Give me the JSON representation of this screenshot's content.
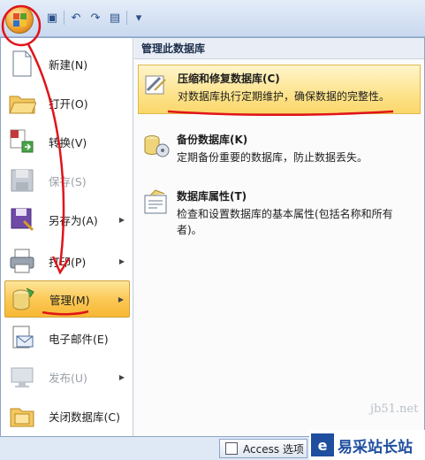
{
  "quick_access": {
    "icons": [
      "save-icon",
      "undo-icon",
      "redo-icon",
      "customize-icon"
    ]
  },
  "left_menu": {
    "items": [
      {
        "label": "新建(N)",
        "icon": "new-file-icon",
        "enabled": true,
        "has_submenu": false
      },
      {
        "label": "打开(O)",
        "icon": "open-folder-icon",
        "enabled": true,
        "has_submenu": false
      },
      {
        "label": "转换(V)",
        "icon": "convert-icon",
        "enabled": true,
        "has_submenu": false
      },
      {
        "label": "保存(S)",
        "icon": "save-icon",
        "enabled": false,
        "has_submenu": false
      },
      {
        "label": "另存为(A)",
        "icon": "save-as-icon",
        "enabled": true,
        "has_submenu": true
      },
      {
        "label": "打印(P)",
        "icon": "printer-icon",
        "enabled": true,
        "has_submenu": true
      },
      {
        "label": "管理(M)",
        "icon": "manage-icon",
        "enabled": true,
        "has_submenu": true
      },
      {
        "label": "电子邮件(E)",
        "icon": "email-icon",
        "enabled": true,
        "has_submenu": false
      },
      {
        "label": "发布(U)",
        "icon": "publish-icon",
        "enabled": false,
        "has_submenu": true
      },
      {
        "label": "关闭数据库(C)",
        "icon": "close-database-icon",
        "enabled": true,
        "has_submenu": false
      }
    ]
  },
  "right_panel": {
    "header": "管理此数据库",
    "items": [
      {
        "title": "压缩和修复数据库(C)",
        "description": "对数据库执行定期维护，确保数据的完整性。",
        "icon": "compact-repair-icon"
      },
      {
        "title": "备份数据库(K)",
        "description": "定期备份重要的数据库，防止数据丢失。",
        "icon": "backup-database-icon"
      },
      {
        "title": "数据库属性(T)",
        "description": "检查和设置数据库的基本属性(包括名称和所有者)。",
        "icon": "database-properties-icon"
      }
    ]
  },
  "bottom": {
    "options_button": "Access 选项"
  },
  "watermark": {
    "site_text": "jb51.net",
    "brand_text": "易采站长站"
  },
  "colors": {
    "highlight": "#fbc957",
    "annotation": "#e0141a",
    "accent": "#1f4f9e"
  }
}
